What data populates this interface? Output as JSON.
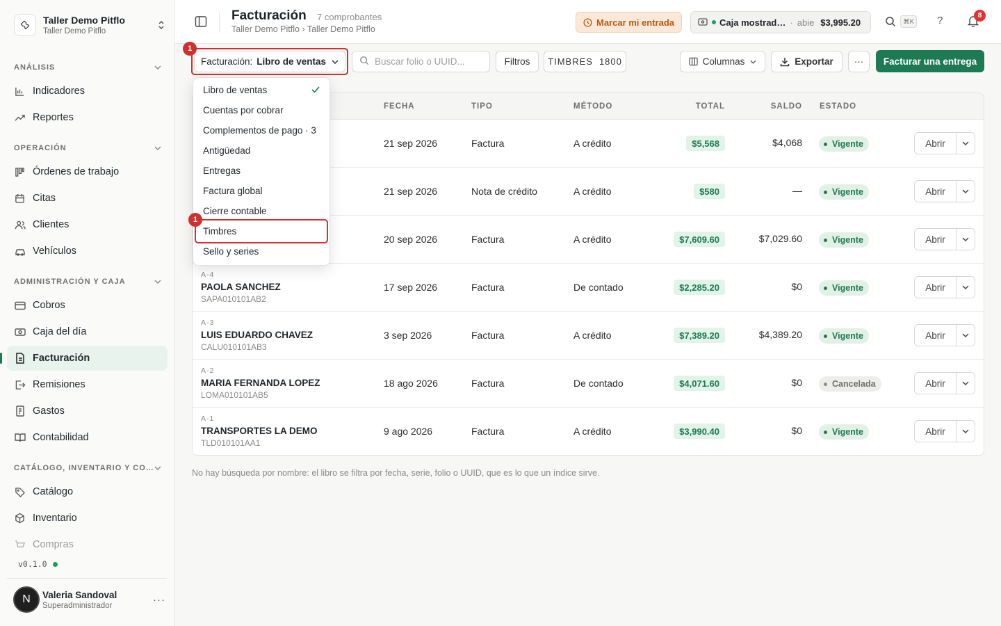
{
  "workspace": {
    "name": "Taller Demo Pitflo",
    "subtitle": "Taller Demo Pitflo"
  },
  "sidebar": {
    "sections": [
      {
        "label": "ANÁLISIS",
        "items": [
          {
            "label": "Indicadores",
            "icon": "bar-chart-icon"
          },
          {
            "label": "Reportes",
            "icon": "trend-icon"
          }
        ]
      },
      {
        "label": "OPERACIÓN",
        "items": [
          {
            "label": "Órdenes de trabajo",
            "icon": "kanban-icon"
          },
          {
            "label": "Citas",
            "icon": "calendar-icon"
          },
          {
            "label": "Clientes",
            "icon": "users-icon"
          },
          {
            "label": "Vehículos",
            "icon": "car-icon"
          }
        ]
      },
      {
        "label": "ADMINISTRACIÓN Y CAJA",
        "items": [
          {
            "label": "Cobros",
            "icon": "card-icon"
          },
          {
            "label": "Caja del día",
            "icon": "cash-icon"
          },
          {
            "label": "Facturación",
            "icon": "invoice-icon"
          },
          {
            "label": "Remisiones",
            "icon": "remision-icon"
          },
          {
            "label": "Gastos",
            "icon": "receipt-icon"
          },
          {
            "label": "Contabilidad",
            "icon": "book-icon"
          }
        ]
      },
      {
        "label": "CATÁLOGO, INVENTARIO Y CO…",
        "items": [
          {
            "label": "Catálogo",
            "icon": "tag-icon"
          },
          {
            "label": "Inventario",
            "icon": "box-icon"
          },
          {
            "label": "Compras",
            "icon": "cart-icon"
          }
        ]
      }
    ],
    "active_item": "Facturación",
    "version": "v0.1.0",
    "user": {
      "initial": "N",
      "name": "Valeria Sandoval",
      "role": "Superadministrador",
      "more": "···"
    }
  },
  "header": {
    "title": "Facturación",
    "count": "7 comprobantes",
    "breadcrumb": "Taller Demo Pitflo › Taller Demo Pitflo",
    "entrada_label": "Marcar mi entrada",
    "caja": {
      "name": "Caja mostrad…",
      "separator": "·",
      "state": "abie",
      "amount": "$3,995.20"
    },
    "shortcut": "⌘K",
    "help": "?",
    "notifications": "8"
  },
  "toolbar": {
    "view_prefix": "Facturación:",
    "view_value": "Libro de ventas",
    "search_placeholder": "Buscar folio o UUID...",
    "filters_label": "Filtros",
    "timbres_label": "TIMBRES",
    "timbres_count": "1800",
    "columns_label": "Columnas",
    "export_label": "Exportar",
    "more_label": "···",
    "primary_label": "Facturar una entrega"
  },
  "annotations": {
    "step_1": "1",
    "step_2": "1"
  },
  "menu": {
    "items": [
      "Libro de ventas",
      "Cuentas por cobrar",
      "Complementos de pago · 3",
      "Antigüedad",
      "Entregas",
      "Factura global",
      "Cierre contable",
      "Timbres",
      "Sello y series"
    ],
    "selected": "Libro de ventas",
    "highlighted": "Timbres"
  },
  "table": {
    "columns": {
      "fecha": "FECHA",
      "tipo": "TIPO",
      "metodo": "MÉTODO",
      "total": "TOTAL",
      "saldo": "SALDO",
      "estado": "ESTADO"
    },
    "open_label": "Abrir",
    "rows": [
      {
        "folio": "",
        "cliente": "",
        "rfc": "",
        "fecha": "21 sep 2026",
        "tipo": "Factura",
        "metodo": "A crédito",
        "total": "$5,568",
        "saldo": "$4,068",
        "estado": "Vigente"
      },
      {
        "folio": "",
        "cliente": "",
        "rfc": "",
        "fecha": "21 sep 2026",
        "tipo": "Nota de crédito",
        "metodo": "A crédito",
        "total": "$580",
        "saldo": "—",
        "estado": "Vigente"
      },
      {
        "folio": "",
        "cliente": "",
        "rfc": "",
        "fecha": "20 sep 2026",
        "tipo": "Factura",
        "metodo": "A crédito",
        "total": "$7,609.60",
        "saldo": "$7,029.60",
        "estado": "Vigente"
      },
      {
        "folio": "A-4",
        "cliente": "PAOLA SANCHEZ",
        "rfc": "SAPA010101AB2",
        "fecha": "17 sep 2026",
        "tipo": "Factura",
        "metodo": "De contado",
        "total": "$2,285.20",
        "saldo": "$0",
        "estado": "Vigente"
      },
      {
        "folio": "A-3",
        "cliente": "LUIS EDUARDO CHAVEZ",
        "rfc": "CALU010101AB3",
        "fecha": "3 sep 2026",
        "tipo": "Factura",
        "metodo": "A crédito",
        "total": "$7,389.20",
        "saldo": "$4,389.20",
        "estado": "Vigente"
      },
      {
        "folio": "A-2",
        "cliente": "MARIA FERNANDA LOPEZ",
        "rfc": "LOMA010101AB5",
        "fecha": "18 ago 2026",
        "tipo": "Factura",
        "metodo": "De contado",
        "total": "$4,071.60",
        "saldo": "$0",
        "estado": "Cancelada"
      },
      {
        "folio": "A-1",
        "cliente": "TRANSPORTES LA DEMO",
        "rfc": "TLD010101AA1",
        "fecha": "9 ago 2026",
        "tipo": "Factura",
        "metodo": "A crédito",
        "total": "$3,990.40",
        "saldo": "$0",
        "estado": "Vigente"
      }
    ]
  },
  "footer_note": "No hay búsqueda por nombre: el libro se filtra por fecha, serie, folio o UUID, que es lo que un índice sirve.",
  "colors": {
    "accent": "#1d7a52",
    "highlight": "#d0302f",
    "warning_bg": "#fbe8d8"
  }
}
